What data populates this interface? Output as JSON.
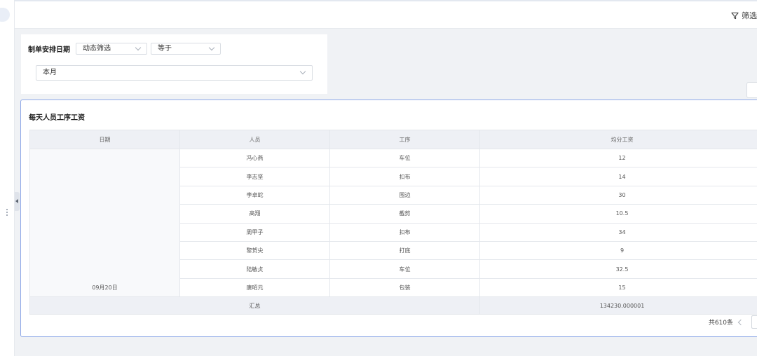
{
  "header": {
    "filter_label": "筛选"
  },
  "filter": {
    "field_label": "制单安排日期",
    "mode": "动态筛选",
    "operator": "等于",
    "value": "本月"
  },
  "table": {
    "title": "每天人员工序工资",
    "columns": [
      "日期",
      "人员",
      "工序",
      "均分工资"
    ],
    "date": "09月20日",
    "rows": [
      {
        "person": "冯心燕",
        "process": "车位",
        "wage": "12"
      },
      {
        "person": "李志坚",
        "process": "扣布",
        "wage": "14"
      },
      {
        "person": "李卓蛇",
        "process": "围边",
        "wage": "30"
      },
      {
        "person": "高翔",
        "process": "截剪",
        "wage": "10.5"
      },
      {
        "person": "周甲子",
        "process": "扣布",
        "wage": "34"
      },
      {
        "person": "黎贺尖",
        "process": "打底",
        "wage": "9"
      },
      {
        "person": "陆敏贞",
        "process": "车位",
        "wage": "32.5"
      },
      {
        "person": "唐昭元",
        "process": "包装",
        "wage": "15"
      }
    ],
    "summary_label": "汇总",
    "summary_value": "134230.000001"
  },
  "pagination": {
    "total": "共610条"
  },
  "colors": {
    "accent_border": "#8fa9e8",
    "header_bg": "#eef0f5"
  },
  "icons": {
    "filter": "funnel-icon"
  }
}
